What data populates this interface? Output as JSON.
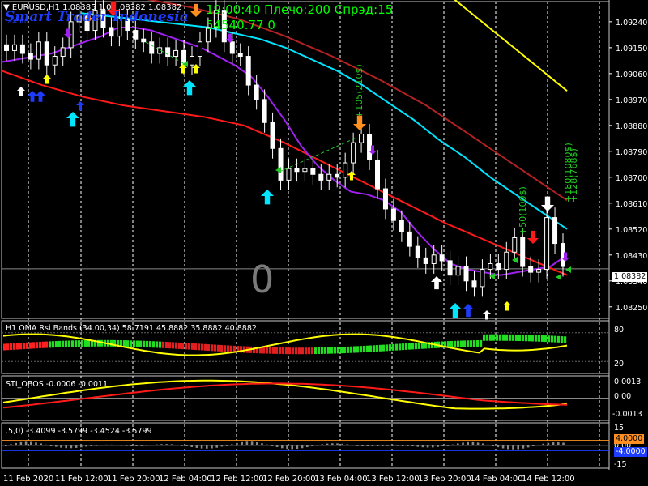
{
  "header": {
    "symbol": "EURUSD,H1",
    "ohlc": "1.08385 1.0",
    "close_tail": "08382 1.08382",
    "brand": "Smart Trader Indonesia",
    "small": "a#5r0",
    "status_line": "19:00:40 Плечо:200 Спрэд:15",
    "balance_line": "54540.77 0"
  },
  "big_counter": "0",
  "price_scale": [
    "1.09240",
    "1.09150",
    "1.09060",
    "1.08970",
    "1.08880",
    "1.08790",
    "1.08700",
    "1.08610",
    "1.08520",
    "1.08430",
    "1.08340",
    "1.08250"
  ],
  "current_price": "1.08382",
  "trade_labels": [
    {
      "text": "+105(210$)"
    },
    {
      "text": "+50(100$)"
    },
    {
      "text": "+180(1080$)"
    },
    {
      "text": "+128(768$)"
    }
  ],
  "indicators": {
    "rsi": {
      "title": "H1 OMA Rsi Bands (34.00,34) 58.7191 45.8882 35.8882 40.8882",
      "scale": [
        "80",
        "20"
      ]
    },
    "obos": {
      "title": "STI_OBOS -0.0006 -0.0011",
      "scale": [
        "0.0013",
        "0.00",
        "-0.0013"
      ]
    },
    "hist": {
      "title": ".5,0) -3.4099 -3.5799 -3.4524 -3.5799",
      "scale": [
        "15",
        "0.00",
        "-15"
      ],
      "tag_high": "4.0000",
      "tag_low": "-4.0000"
    }
  },
  "time_axis": [
    "11 Feb 2020",
    "11 Feb 12:00",
    "11 Feb 20:00",
    "12 Feb 04:00",
    "12 Feb 12:00",
    "12 Feb 20:00",
    "13 Feb 04:00",
    "13 Feb 12:00",
    "13 Feb 20:00",
    "14 Feb 04:00",
    "14 Feb 12:00"
  ],
  "colors": {
    "bg": "#000000",
    "candle": "#ffffff",
    "cyan": "#00e5ff",
    "red": "#ff1a1a",
    "darkred": "#b22222",
    "purple": "#a020f0",
    "yellow": "#ffff00",
    "green": "#22cc22",
    "blue": "#1e3cff",
    "orange": "#ff9020",
    "brand": "#1e3cff",
    "status": "#00ff00",
    "grid": "#ffffff"
  },
  "chart_data": [
    {
      "type": "candlestick",
      "title": "EURUSD,H1",
      "ylim": [
        1.0821,
        1.0931
      ],
      "close_series": [
        1.0914,
        1.0916,
        1.0913,
        1.0911,
        1.0917,
        1.0909,
        1.0912,
        1.0915,
        1.0924,
        1.0926,
        1.0921,
        1.0928,
        1.0922,
        1.0919,
        1.0925,
        1.0921,
        1.0918,
        1.0917,
        1.0913,
        1.0915,
        1.0912,
        1.0914,
        1.0909,
        1.0912,
        1.0917,
        1.0922,
        1.0928,
        1.0917,
        1.0913,
        1.0912,
        1.0902,
        1.0897,
        1.0889,
        1.088,
        1.0869,
        1.0873,
        1.0872,
        1.0873,
        1.0871,
        1.0869,
        1.0871,
        1.087,
        1.0875,
        1.0882,
        1.0885,
        1.0876,
        1.0866,
        1.0859,
        1.0855,
        1.0851,
        1.0846,
        1.0842,
        1.084,
        1.0843,
        1.0841,
        1.0836,
        1.0839,
        1.0834,
        1.0832,
        1.0838,
        1.084,
        1.0838,
        1.0844,
        1.0849,
        1.0839,
        1.0837,
        1.0838,
        1.0856,
        1.0847,
        1.0839
      ],
      "ema_fast_purple": [
        1.091,
        1.0911,
        1.0912,
        1.0913,
        1.0915,
        1.0917,
        1.0919,
        1.0922,
        1.0922,
        1.0921,
        1.0919,
        1.0917,
        1.0915,
        1.0912,
        1.0909,
        1.0905,
        1.0898,
        1.089,
        1.0881,
        1.0874,
        1.0869,
        1.0865,
        1.0864,
        1.0862,
        1.0858,
        1.0851,
        1.0845,
        1.084,
        1.0838,
        1.0837,
        1.0836,
        1.0837,
        1.0838,
        1.0839,
        1.0843
      ],
      "ma_cyan": [
        1.0927,
        1.0926,
        1.0925,
        1.0924,
        1.0923,
        1.0922,
        1.092,
        1.0918,
        1.0915,
        1.0911,
        1.0907,
        1.0902,
        1.0896,
        1.089,
        1.0883,
        1.0877,
        1.087,
        1.0864,
        1.0858,
        1.0852
      ],
      "ma_red": [
        1.0907,
        1.0902,
        1.0898,
        1.0895,
        1.0893,
        1.0891,
        1.0888,
        1.0882,
        1.0875,
        1.0868,
        1.0861,
        1.0854,
        1.0848,
        1.0842,
        1.0836
      ],
      "ma_darkred": [
        1.0935,
        1.0932,
        1.0929,
        1.0925,
        1.0919,
        1.0912,
        1.0904,
        1.0895,
        1.0884,
        1.0873,
        1.0862
      ],
      "ma_yellow": [
        1.094,
        1.093,
        1.092,
        1.091,
        1.09
      ]
    }
  ]
}
